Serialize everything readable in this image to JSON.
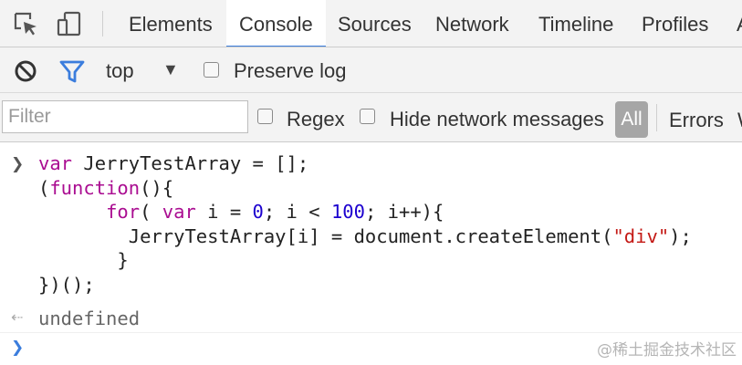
{
  "tabs": [
    {
      "label": "Elements",
      "active": false
    },
    {
      "label": "Console",
      "active": true
    },
    {
      "label": "Sources",
      "active": false
    },
    {
      "label": "Network",
      "active": false
    },
    {
      "label": "Timeline",
      "active": false
    },
    {
      "label": "Profiles",
      "active": false
    },
    {
      "label": "A",
      "active": false
    }
  ],
  "toolbar": {
    "context": "top",
    "preserve_log_label": "Preserve log",
    "preserve_log_checked": false
  },
  "filterbar": {
    "filter_placeholder": "Filter",
    "regex_label": "Regex",
    "hide_network_label": "Hide network messages",
    "levels": [
      "All",
      "Errors",
      "W"
    ]
  },
  "console": {
    "input_lines": [
      "var JerryTestArray = [];",
      "(function(){",
      "      for( var i = 0; i < 100; i++){",
      "        JerryTestArray[i] = document.createElement(\"div\");",
      "       }",
      "})();"
    ],
    "result": "undefined"
  },
  "watermark": "@稀土掘金技术社区",
  "colors": {
    "accent": "#3b7ddd",
    "keyword": "#aa0d91",
    "number": "#1c00cf",
    "string": "#c41a16",
    "prompt": "#3b7ddd"
  },
  "icons": {
    "inspect": "inspect-element-icon",
    "device": "device-mode-icon",
    "clear": "clear-console-icon",
    "filter": "filter-icon",
    "input_prompt": "chevron-right-icon",
    "result_prompt": "result-arrow-icon"
  }
}
